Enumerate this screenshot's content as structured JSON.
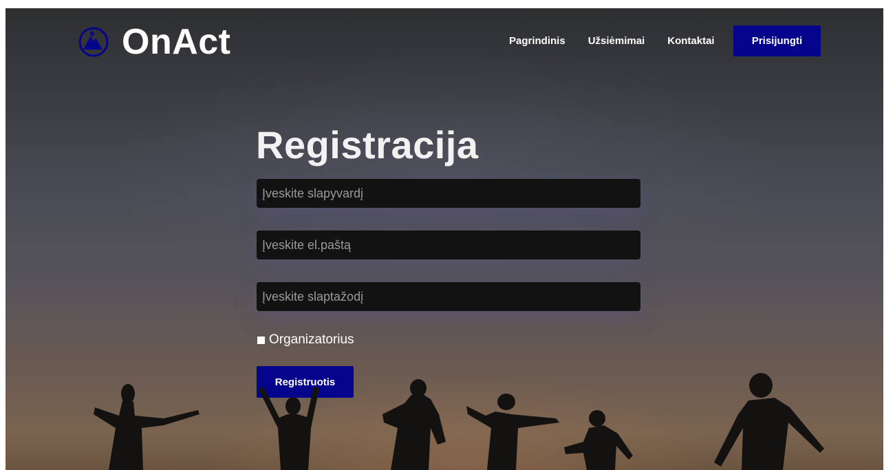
{
  "brand": {
    "name": "OnAct",
    "logo_icon": "mountain-flame-icon",
    "accent_color": "#05058c"
  },
  "nav": {
    "items": [
      {
        "label": "Pagrindinis"
      },
      {
        "label": "Užsiėmimai"
      },
      {
        "label": "Kontaktai"
      }
    ],
    "login_label": "Prisijungti"
  },
  "form": {
    "title": "Registracija",
    "username": {
      "placeholder": "Įveskite slapyvardį",
      "value": ""
    },
    "email": {
      "placeholder": "Įveskite el.paštą",
      "value": ""
    },
    "password": {
      "placeholder": "Įveskite slaptažodį",
      "value": ""
    },
    "organizer_label": "Organizatorius",
    "organizer_checked": false,
    "submit_label": "Registruotis"
  }
}
